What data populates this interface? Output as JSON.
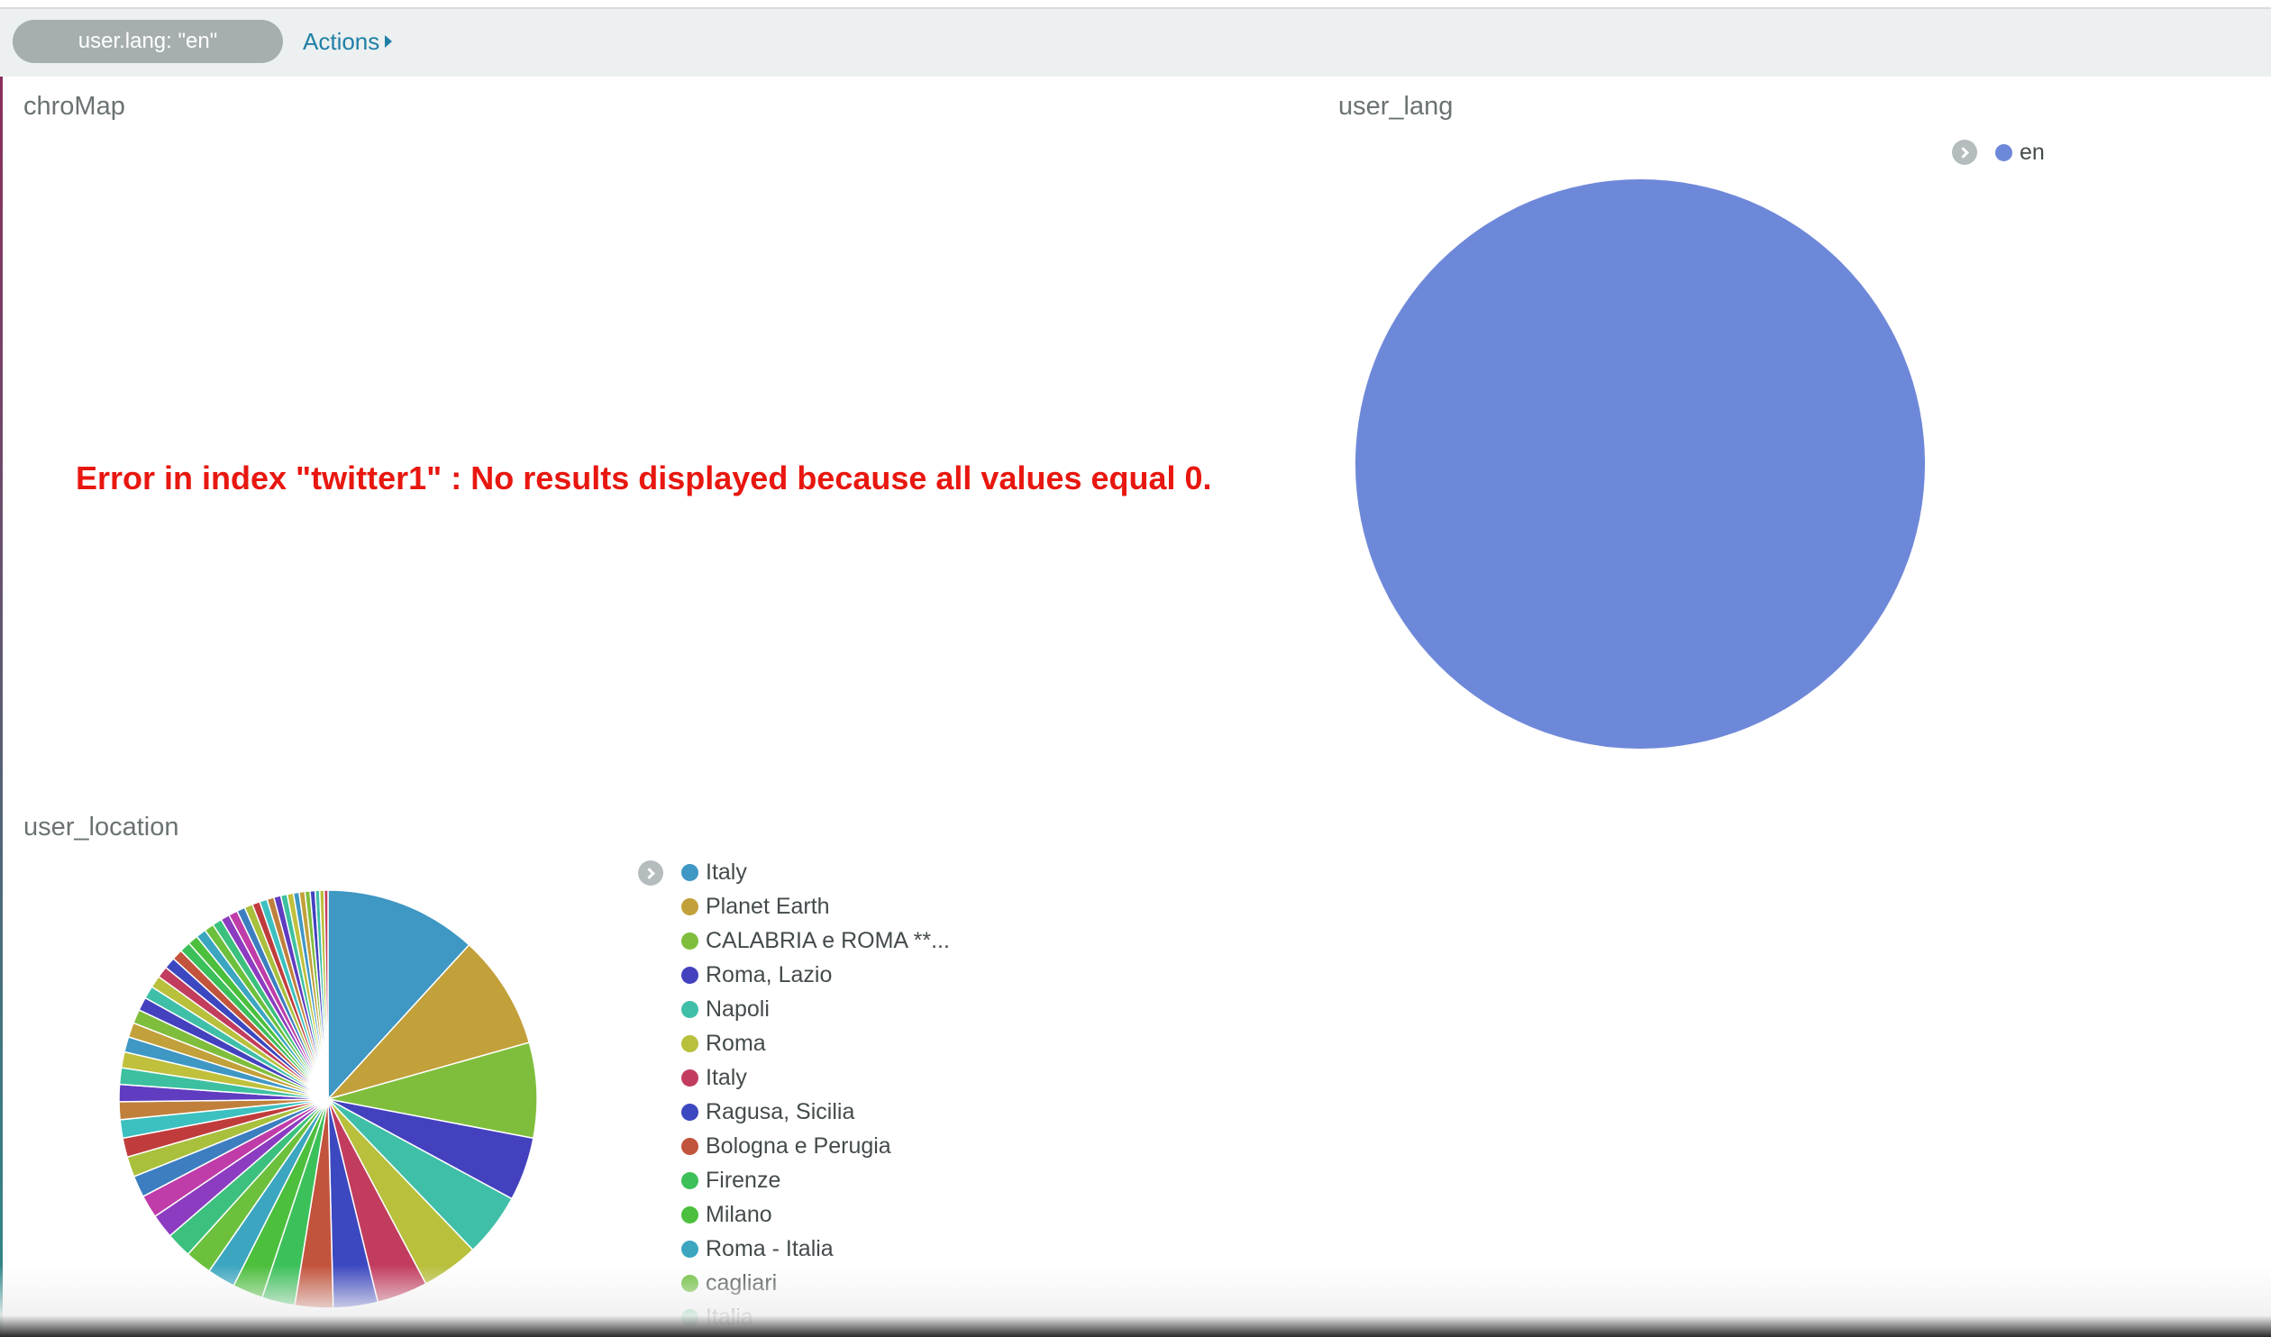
{
  "filter": {
    "pill_label": "user.lang: \"en\"",
    "actions_label": "Actions"
  },
  "panels": {
    "chromap": {
      "title": "chroMap",
      "error": "Error in index \"twitter1\" : No results displayed because all values equal 0."
    },
    "user_lang": {
      "title": "user_lang",
      "legend": [
        {
          "label": "en",
          "color": "#6e88d9"
        }
      ]
    },
    "user_location": {
      "title": "user_location",
      "legend": [
        {
          "label": "Italy",
          "color": "#3f97c4"
        },
        {
          "label": "Planet Earth",
          "color": "#c2a03a"
        },
        {
          "label": "CALABRIA e ROMA **...",
          "color": "#7fbe3c"
        },
        {
          "label": "Roma, Lazio",
          "color": "#4441bf"
        },
        {
          "label": "Napoli",
          "color": "#3fbfa8"
        },
        {
          "label": "Roma",
          "color": "#b8c03c"
        },
        {
          "label": "Italy",
          "color": "#c23c5e"
        },
        {
          "label": "Ragusa, Sicilia",
          "color": "#3c48c0"
        },
        {
          "label": "Bologna e Perugia",
          "color": "#c2533c"
        },
        {
          "label": "Firenze",
          "color": "#3cc05a"
        },
        {
          "label": "Milano",
          "color": "#4cbf3c"
        },
        {
          "label": "Roma - Italia",
          "color": "#3ca6c0"
        },
        {
          "label": "cagliari",
          "color": "#6cc03c"
        },
        {
          "label": "Italia",
          "color": "#3cc07e"
        }
      ]
    }
  },
  "chart_data": [
    {
      "type": "pie",
      "title": "user_lang",
      "categories": [
        "en"
      ],
      "values": [
        100
      ],
      "colors": [
        "#6e88d9"
      ]
    },
    {
      "type": "pie",
      "title": "user_location",
      "values": [
        12,
        9,
        7.5,
        5,
        5,
        4.5,
        4,
        3.5,
        3,
        2.6,
        2.4,
        2.2,
        2.1,
        2.0,
        1.9,
        1.8,
        1.7,
        1.6,
        1.5,
        1.45,
        1.4,
        1.35,
        1.3,
        1.25,
        1.2,
        1.15,
        1.1,
        1.05,
        1.0,
        0.95,
        0.9,
        0.9,
        0.85,
        0.85,
        0.8,
        0.8,
        0.75,
        0.75,
        0.7,
        0.7,
        0.65,
        0.65,
        0.6,
        0.6,
        0.55,
        0.55,
        0.5,
        0.5,
        0.45,
        0.45,
        0.4,
        0.4,
        0.35,
        0.35,
        0.3
      ],
      "colors": [
        "#3f97c4",
        "#c2a03a",
        "#7fbe3c",
        "#4441bf",
        "#3fbfa8",
        "#b8c03c",
        "#c23c5e",
        "#3c48c0",
        "#c2533c",
        "#3cc05a",
        "#4cbf3c",
        "#3ca6c0",
        "#6cc03c",
        "#3cc07e",
        "#8c3cc0",
        "#c03ca8",
        "#3c7ec0",
        "#a8c03c",
        "#c03c3c",
        "#3cc0c0",
        "#c0803c",
        "#603cc0",
        "#3cc0a0",
        "#c0c03c"
      ]
    }
  ]
}
